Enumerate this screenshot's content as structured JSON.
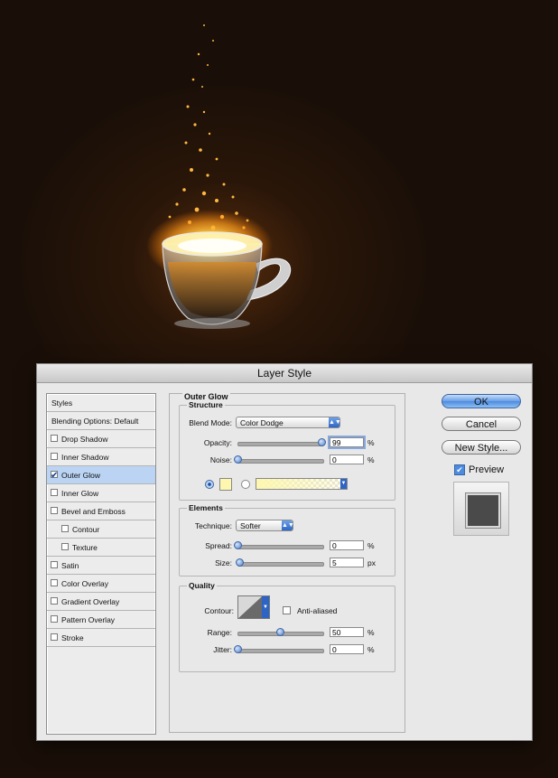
{
  "dialog": {
    "title": "Layer Style"
  },
  "styles_list": {
    "header": "Styles",
    "blending_options": "Blending Options: Default",
    "items": [
      {
        "label": "Drop Shadow",
        "checked": false,
        "selected": false,
        "indent": false
      },
      {
        "label": "Inner Shadow",
        "checked": false,
        "selected": false,
        "indent": false
      },
      {
        "label": "Outer Glow",
        "checked": true,
        "selected": true,
        "indent": false
      },
      {
        "label": "Inner Glow",
        "checked": false,
        "selected": false,
        "indent": false
      },
      {
        "label": "Bevel and Emboss",
        "checked": false,
        "selected": false,
        "indent": false
      },
      {
        "label": "Contour",
        "checked": false,
        "selected": false,
        "indent": true
      },
      {
        "label": "Texture",
        "checked": false,
        "selected": false,
        "indent": true
      },
      {
        "label": "Satin",
        "checked": false,
        "selected": false,
        "indent": false
      },
      {
        "label": "Color Overlay",
        "checked": false,
        "selected": false,
        "indent": false
      },
      {
        "label": "Gradient Overlay",
        "checked": false,
        "selected": false,
        "indent": false
      },
      {
        "label": "Pattern Overlay",
        "checked": false,
        "selected": false,
        "indent": false
      },
      {
        "label": "Stroke",
        "checked": false,
        "selected": false,
        "indent": false
      }
    ]
  },
  "outer_glow": {
    "title": "Outer Glow",
    "structure": {
      "title": "Structure",
      "blend_mode_label": "Blend Mode:",
      "blend_mode_value": "Color Dodge",
      "opacity_label": "Opacity:",
      "opacity_value": "99",
      "opacity_unit": "%",
      "opacity_fraction": 0.99,
      "noise_label": "Noise:",
      "noise_value": "0",
      "noise_unit": "%",
      "noise_fraction": 0,
      "glow_color": "#fdf7b0"
    },
    "elements": {
      "title": "Elements",
      "technique_label": "Technique:",
      "technique_value": "Softer",
      "spread_label": "Spread:",
      "spread_value": "0",
      "spread_unit": "%",
      "spread_fraction": 0,
      "size_label": "Size:",
      "size_value": "5",
      "size_unit": "px",
      "size_fraction": 0.02
    },
    "quality": {
      "title": "Quality",
      "contour_label": "Contour:",
      "anti_aliased_label": "Anti-aliased",
      "anti_aliased_checked": false,
      "range_label": "Range:",
      "range_value": "50",
      "range_unit": "%",
      "range_fraction": 0.5,
      "jitter_label": "Jitter:",
      "jitter_value": "0",
      "jitter_unit": "%",
      "jitter_fraction": 0
    }
  },
  "buttons": {
    "ok": "OK",
    "cancel": "Cancel",
    "new_style": "New Style...",
    "preview_label": "Preview",
    "preview_checked": true
  },
  "colors": {
    "accent": "#4d8be0",
    "selection": "#bcd4f4",
    "glow": "#ffb52e",
    "background": "#1a0f08"
  }
}
